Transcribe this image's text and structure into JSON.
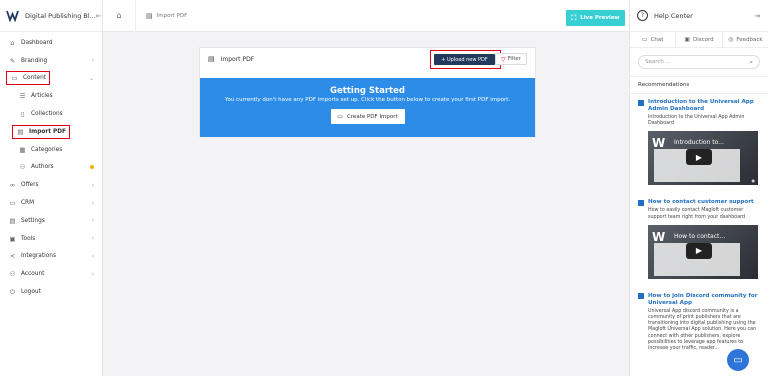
{
  "brand": {
    "name": "Digital Publishing Bl...",
    "logo_icon": "magloft-logo-icon"
  },
  "sidebar": {
    "items": [
      {
        "label": "Dashboard",
        "icon": "home-icon",
        "glyph": "⌂",
        "chevron": ""
      },
      {
        "label": "Branding",
        "icon": "brush-icon",
        "glyph": "✎",
        "chevron": "‹"
      },
      {
        "label": "Content",
        "icon": "folder-icon",
        "glyph": "▭",
        "chevron": "⌄"
      },
      {
        "label": "Articles",
        "icon": "list-icon",
        "glyph": "☰",
        "chevron": ""
      },
      {
        "label": "Collections",
        "icon": "book-icon",
        "glyph": "▯",
        "chevron": ""
      },
      {
        "label": "Import PDF",
        "icon": "pdf-icon",
        "glyph": "▤",
        "chevron": ""
      },
      {
        "label": "Categories",
        "icon": "grid-icon",
        "glyph": "▦",
        "chevron": ""
      },
      {
        "label": "Authors",
        "icon": "users-icon",
        "glyph": "⚇",
        "chevron": ""
      },
      {
        "label": "Offers",
        "icon": "infinity-icon",
        "glyph": "∞",
        "chevron": "‹"
      },
      {
        "label": "CRM",
        "icon": "chat-icon",
        "glyph": "▭",
        "chevron": "‹"
      },
      {
        "label": "Settings",
        "icon": "settings-icon",
        "glyph": "▤",
        "chevron": "‹"
      },
      {
        "label": "Tools",
        "icon": "toolbox-icon",
        "glyph": "▣",
        "chevron": "‹"
      },
      {
        "label": "Integrations",
        "icon": "share-icon",
        "glyph": "≺",
        "chevron": "‹"
      },
      {
        "label": "Account",
        "icon": "account-icon",
        "glyph": "⚇",
        "chevron": "‹"
      },
      {
        "label": "Logout",
        "icon": "logout-icon",
        "glyph": "⏻",
        "chevron": ""
      }
    ]
  },
  "topbar": {
    "breadcrumb": "Import PDF",
    "live_preview": "Live Preview"
  },
  "card": {
    "title": "Import PDF",
    "upload_label": "+ Upload new PDF",
    "filter_label": "Filter",
    "banner_title": "Getting Started",
    "banner_text": "You currently don't have any PDF imports set up. Click the button below to create your first PDF import.",
    "create_label": "Create PDF Import"
  },
  "help": {
    "title": "Help Center",
    "tabs": [
      "Chat",
      "Discord",
      "Feedback"
    ],
    "search_placeholder": "Search ...",
    "recommendations_label": "Recommendations",
    "articles": [
      {
        "title": "Introduction to the Universal App Admin Dashboard",
        "desc": "Introduction to the Universal App Admin Dashboard",
        "video_title": "Introduction to..."
      },
      {
        "title": "How to contact customer support",
        "desc": "How to easily contact Magloft customer support team right from your dashboard",
        "video_title": "How to contact..."
      },
      {
        "title": "How to join Discord community for Universal App",
        "desc": "Universal App discord community is a community of print publishers that are transitioning into digital publishing using the Magloft Universal App solution. Here you can connect with other publishers, explore possibilities to leverage app features to increase your traffic, reader..."
      }
    ]
  },
  "colors": {
    "accent": "#36cfd3",
    "navy": "#233a5c",
    "banner": "#2d8ce8",
    "highlight": "#e2001a"
  }
}
